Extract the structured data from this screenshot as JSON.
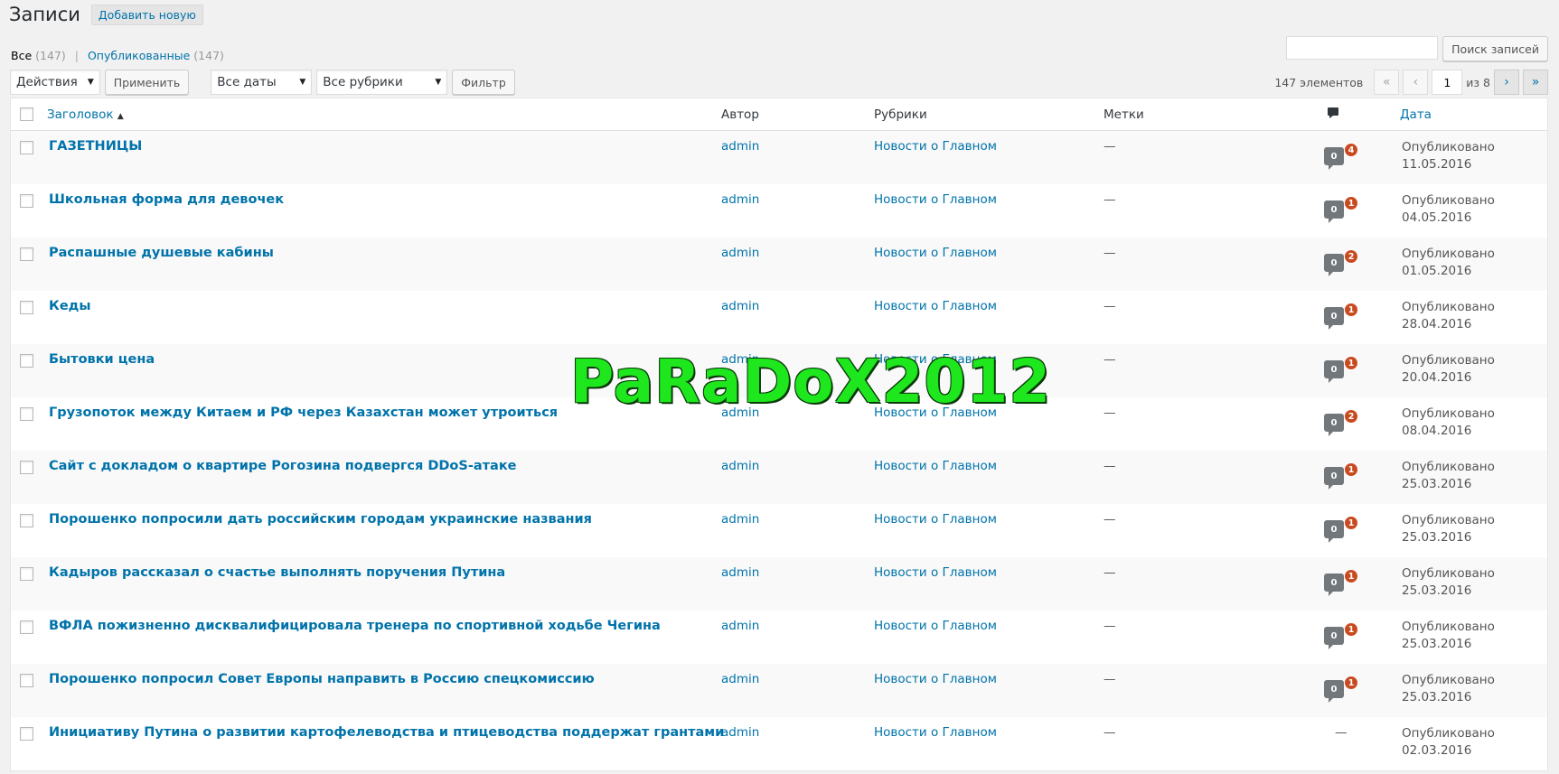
{
  "header": {
    "title": "Записи",
    "add_new": "Добавить новую"
  },
  "views": {
    "all_label": "Все",
    "all_count": "(147)",
    "separator": "|",
    "published_label": "Опубликованные",
    "published_count": "(147)"
  },
  "search": {
    "value": "",
    "button": "Поиск записей"
  },
  "tablenav": {
    "bulk_action": "Действия",
    "apply": "Применить",
    "dates": "Все даты",
    "categories": "Все рубрики",
    "filter": "Фильтр",
    "items_count": "147 элементов",
    "first": "«",
    "prev": "‹",
    "current_page": "1",
    "of_pages": "из 8",
    "next": "›",
    "last": "»"
  },
  "columns": {
    "title": "Заголовок",
    "author": "Автор",
    "categories": "Рубрики",
    "tags": "Метки",
    "comments_icon": "comment-icon",
    "date": "Дата"
  },
  "rows": [
    {
      "title": "ГАЗЕТНИЦЫ",
      "author": "admin",
      "category": "Новости о Главном",
      "tags": "—",
      "comments": "0",
      "pending": "4",
      "status": "Опубликовано",
      "date": "11.05.2016"
    },
    {
      "title": "Школьная форма для девочек",
      "author": "admin",
      "category": "Новости о Главном",
      "tags": "—",
      "comments": "0",
      "pending": "1",
      "status": "Опубликовано",
      "date": "04.05.2016"
    },
    {
      "title": "Распашные душевые кабины",
      "author": "admin",
      "category": "Новости о Главном",
      "tags": "—",
      "comments": "0",
      "pending": "2",
      "status": "Опубликовано",
      "date": "01.05.2016"
    },
    {
      "title": "Кеды",
      "author": "admin",
      "category": "Новости о Главном",
      "tags": "—",
      "comments": "0",
      "pending": "1",
      "status": "Опубликовано",
      "date": "28.04.2016"
    },
    {
      "title": "Бытовки цена",
      "author": "admin",
      "category": "Новости о Главном",
      "tags": "—",
      "comments": "0",
      "pending": "1",
      "status": "Опубликовано",
      "date": "20.04.2016"
    },
    {
      "title": "Грузопоток между Китаем и РФ через Казахстан может утроиться",
      "author": "admin",
      "category": "Новости о Главном",
      "tags": "—",
      "comments": "0",
      "pending": "2",
      "status": "Опубликовано",
      "date": "08.04.2016"
    },
    {
      "title": "Сайт с докладом о квартире Рогозина подвергся DDoS-атаке",
      "author": "admin",
      "category": "Новости о Главном",
      "tags": "—",
      "comments": "0",
      "pending": "1",
      "status": "Опубликовано",
      "date": "25.03.2016"
    },
    {
      "title": "Порошенко попросили дать российским городам украинские названия",
      "author": "admin",
      "category": "Новости о Главном",
      "tags": "—",
      "comments": "0",
      "pending": "1",
      "status": "Опубликовано",
      "date": "25.03.2016"
    },
    {
      "title": "Кадыров рассказал о счастье выполнять поручения Путина",
      "author": "admin",
      "category": "Новости о Главном",
      "tags": "—",
      "comments": "0",
      "pending": "1",
      "status": "Опубликовано",
      "date": "25.03.2016"
    },
    {
      "title": "ВФЛА пожизненно дисквалифицировала тренера по спортивной ходьбе Чегина",
      "author": "admin",
      "category": "Новости о Главном",
      "tags": "—",
      "comments": "0",
      "pending": "1",
      "status": "Опубликовано",
      "date": "25.03.2016"
    },
    {
      "title": "Порошенко попросил Совет Европы направить в Россию спецкомиссию",
      "author": "admin",
      "category": "Новости о Главном",
      "tags": "—",
      "comments": "0",
      "pending": "1",
      "status": "Опубликовано",
      "date": "25.03.2016"
    },
    {
      "title": "Инициативу Путина о развитии картофелеводства и птицеводства поддержат грантами",
      "author": "admin",
      "category": "Новости о Главном",
      "tags": "—",
      "comments": "—",
      "pending": "",
      "status": "Опубликовано",
      "date": "02.03.2016"
    }
  ],
  "watermark": "PaRaDoX2012",
  "colors": {
    "link": "#0073aa",
    "pending_badge": "#ca4a1f",
    "comment_bubble": "#72777c",
    "watermark": "#1ee71e"
  }
}
